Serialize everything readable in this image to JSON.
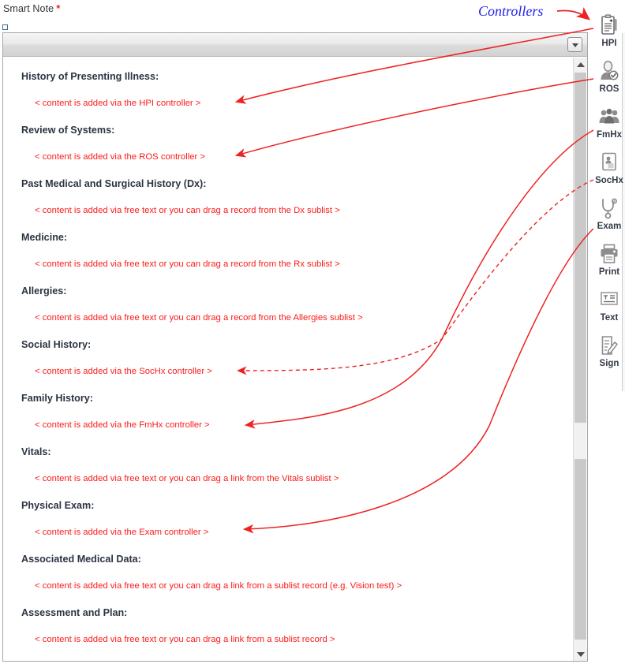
{
  "field": {
    "label": "Smart Note",
    "required_marker": "*"
  },
  "toolbar": {
    "dropdown_name": "toolbar-options-dropdown"
  },
  "note": {
    "sections": [
      {
        "heading": "History of Presenting Illness:",
        "body": "< content is added via the HPI controller >"
      },
      {
        "heading": "Review of Systems:",
        "body": "< content is added via the ROS controller >"
      },
      {
        "heading": "Past Medical and Surgical History (Dx):",
        "body": "< content is added via free text or you can drag a record from the Dx sublist >"
      },
      {
        "heading": "Medicine:",
        "body": "< content is added via free text or you can drag a record from the Rx sublist >"
      },
      {
        "heading": "Allergies:",
        "body": "< content is added via free text or you can drag a record from the Allergies sublist >"
      },
      {
        "heading": "Social History:",
        "body": "< content is added via the SocHx controller >"
      },
      {
        "heading": "Family History:",
        "body": "< content is added via the FmHx controller >"
      },
      {
        "heading": "Vitals:",
        "body": "< content is added via free text or you can drag a link from the Vitals sublist >"
      },
      {
        "heading": "Physical Exam:",
        "body": "< content is added via the Exam controller >"
      },
      {
        "heading": "Associated Medical Data:",
        "body": "< content is added via free text or you can drag a link from a sublist record (e.g. Vision test) >"
      },
      {
        "heading": "Assessment and Plan:",
        "body": "< content is added via free text or you can drag a link from a sublist record >"
      }
    ]
  },
  "controllers": {
    "annotation_label": "Controllers",
    "annotation_color": "#2020ee",
    "arrow_color": "#ee2222",
    "items": [
      {
        "label": "HPI",
        "icon": "clipboard-plus-icon"
      },
      {
        "label": "ROS",
        "icon": "person-check-icon"
      },
      {
        "label": "FmHx",
        "icon": "people-group-icon"
      },
      {
        "label": "SocHx",
        "icon": "id-card-person-icon"
      },
      {
        "label": "Exam",
        "icon": "stethoscope-icon"
      },
      {
        "label": "Print",
        "icon": "printer-icon"
      },
      {
        "label": "Text",
        "icon": "text-block-icon"
      },
      {
        "label": "Sign",
        "icon": "signature-pen-icon"
      }
    ]
  },
  "scrollbar": {
    "up_icon": "chevron-up-icon",
    "down_icon": "chevron-down-icon"
  }
}
